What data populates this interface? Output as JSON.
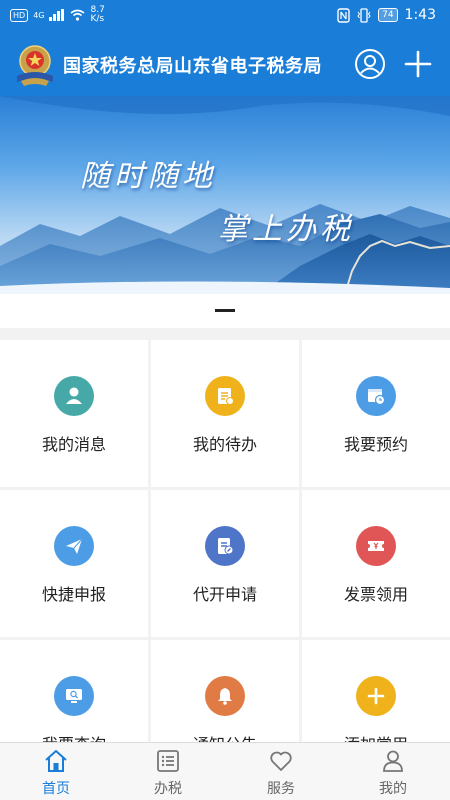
{
  "status_bar": {
    "hd": "HD",
    "network": "4G",
    "speed_value": "8.7",
    "speed_unit": "K/s",
    "battery": "74",
    "time": "1:43"
  },
  "header": {
    "title": "国家税务总局山东省电子税务局",
    "emblem_icon": "tax-emblem",
    "user_icon": "user-icon",
    "add_icon": "plus-icon",
    "bg_color": "#1a7ed8"
  },
  "banner": {
    "line1": "随时随地",
    "line2": "掌上办税"
  },
  "grid": {
    "items": [
      {
        "label": "我的消息",
        "icon": "person-icon",
        "color": "#47a9a7"
      },
      {
        "label": "我的待办",
        "icon": "todo-list-icon",
        "color": "#f0b21b"
      },
      {
        "label": "我要预约",
        "icon": "calendar-clock-icon",
        "color": "#4d9de6"
      },
      {
        "label": "快捷申报",
        "icon": "paper-plane-icon",
        "color": "#4d9de6"
      },
      {
        "label": "代开申请",
        "icon": "document-edit-icon",
        "color": "#4e75c8"
      },
      {
        "label": "发票领用",
        "icon": "ticket-icon",
        "color": "#e05656"
      },
      {
        "label": "我要查询",
        "icon": "monitor-search-icon",
        "color": "#4d9de6"
      },
      {
        "label": "通知公告",
        "icon": "bell-icon",
        "color": "#e07b45"
      },
      {
        "label": "添加常用",
        "icon": "plus-icon",
        "color": "#f0b21b"
      }
    ]
  },
  "bottom_nav": {
    "items": [
      {
        "label": "首页",
        "icon": "home-icon",
        "active": true
      },
      {
        "label": "办税",
        "icon": "list-icon",
        "active": false
      },
      {
        "label": "服务",
        "icon": "heart-icon",
        "active": false
      },
      {
        "label": "我的",
        "icon": "person-outline-icon",
        "active": false
      }
    ],
    "active_color": "#1a7ed8"
  }
}
